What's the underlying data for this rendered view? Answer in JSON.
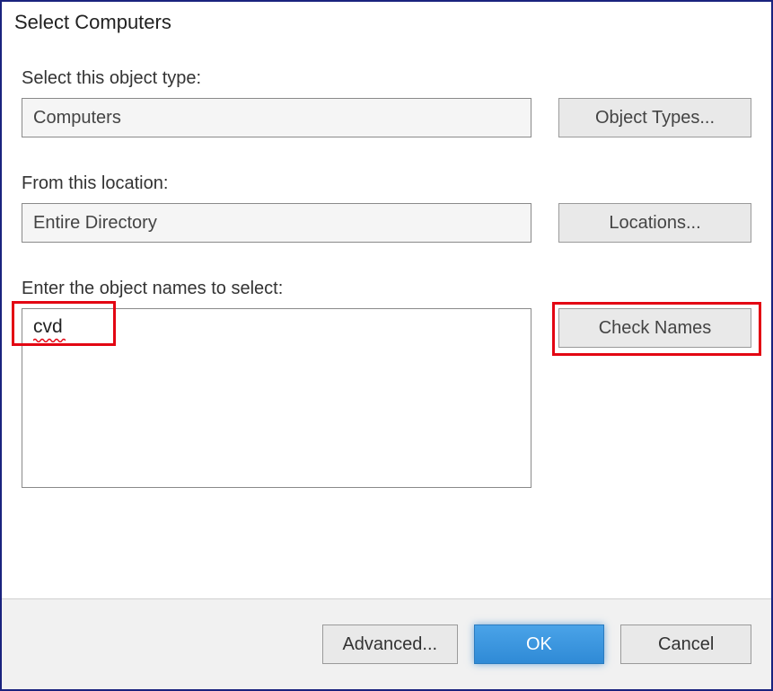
{
  "dialog": {
    "title": "Select Computers",
    "object_type_label": "Select this object type:",
    "object_type_value": "Computers",
    "object_types_button": "Object Types...",
    "location_label": "From this location:",
    "location_value": "Entire Directory",
    "locations_button": "Locations...",
    "names_label": "Enter the object names to select:",
    "names_value": "cvd",
    "check_names_button": "Check Names",
    "advanced_button": "Advanced...",
    "ok_button": "OK",
    "cancel_button": "Cancel"
  }
}
